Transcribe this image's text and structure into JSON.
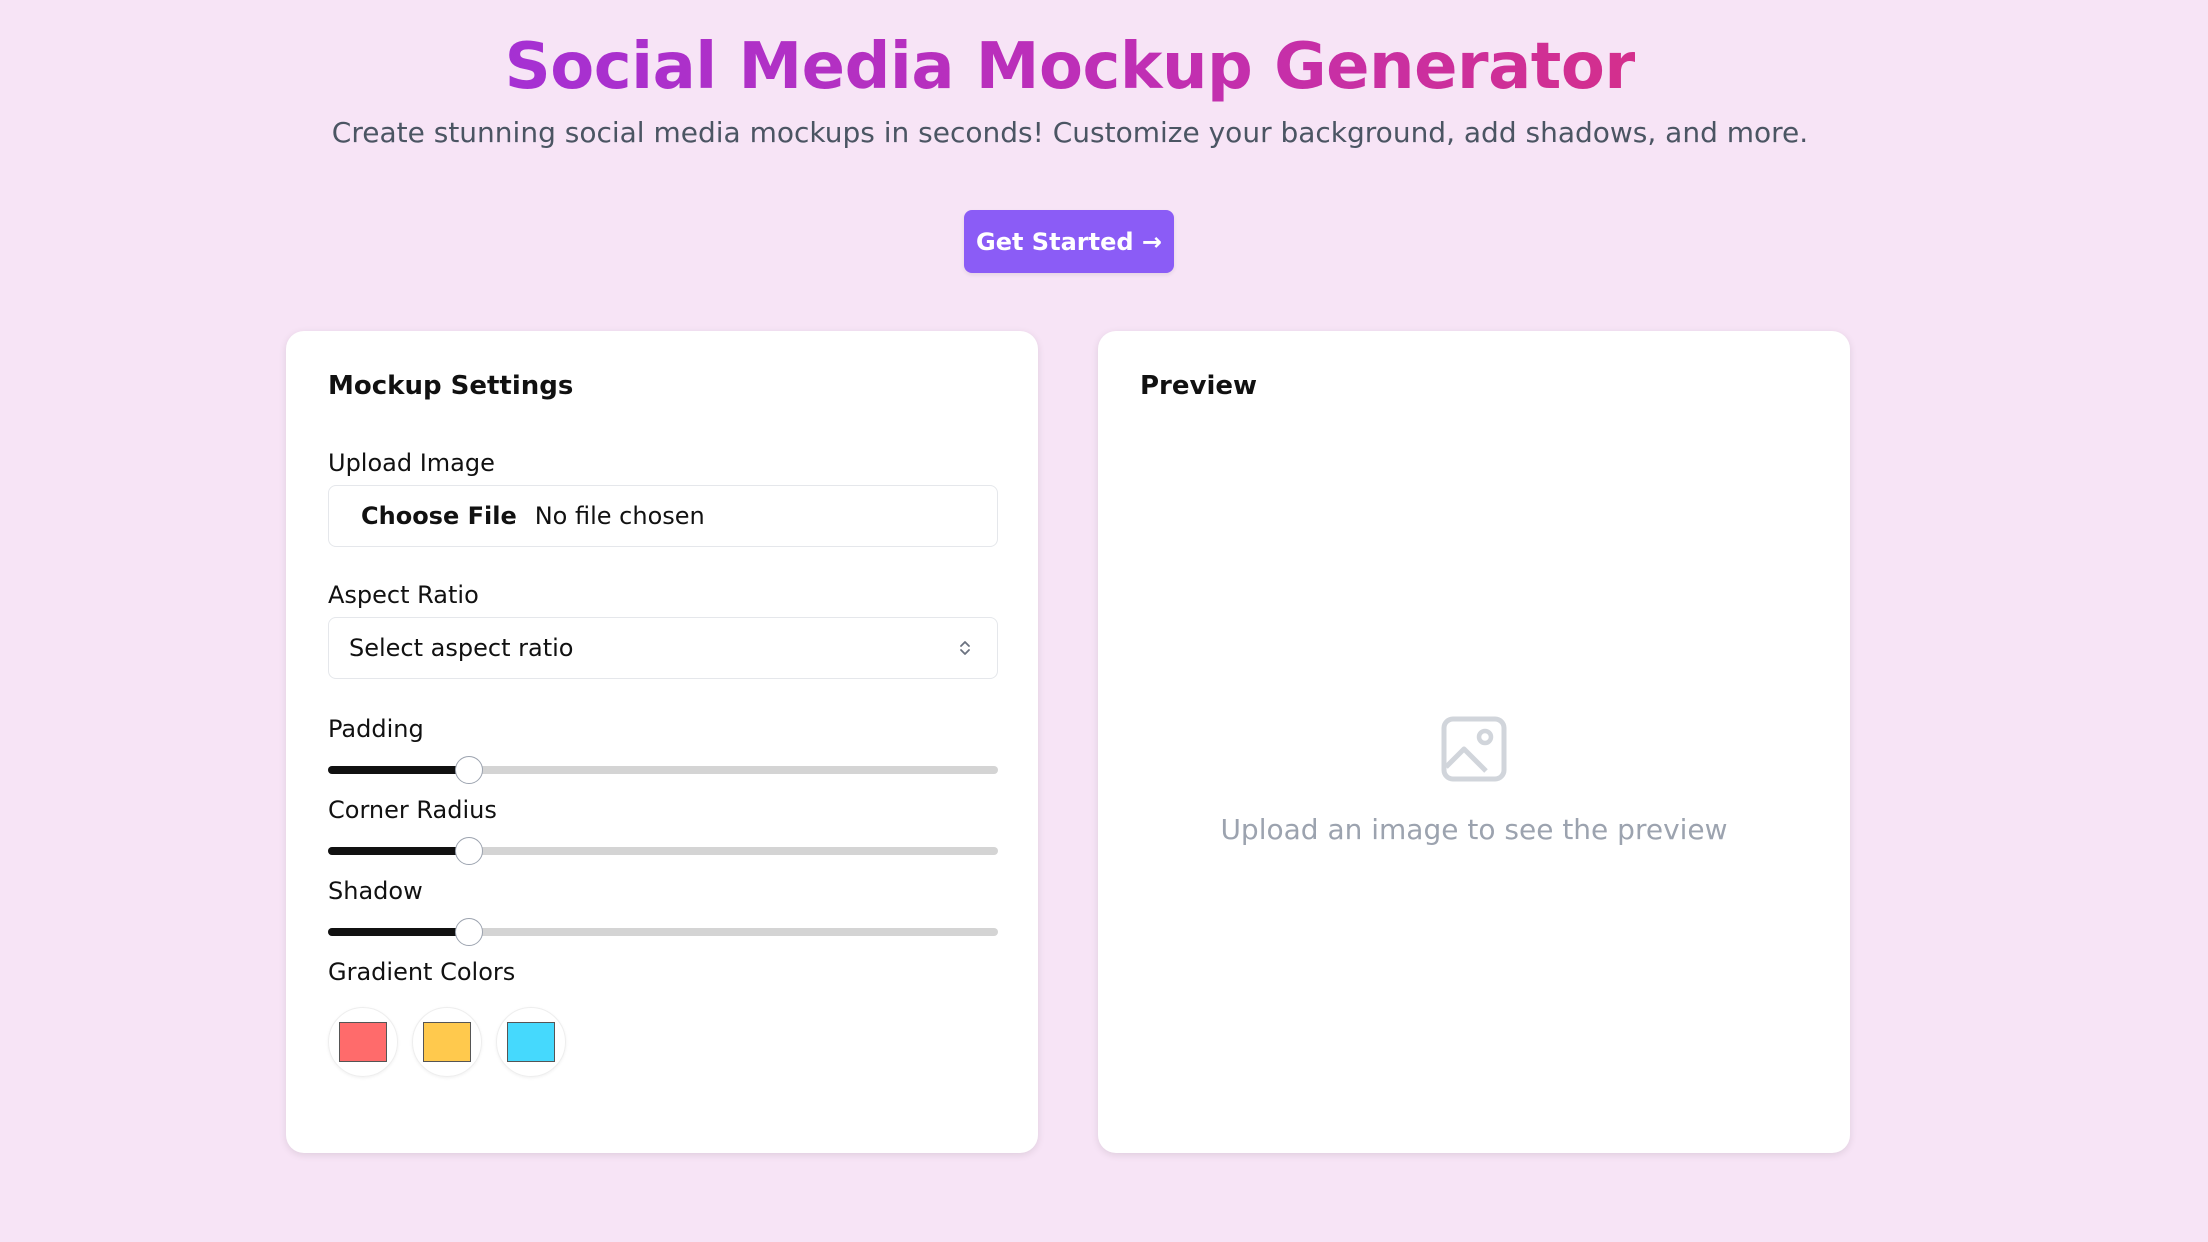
{
  "header": {
    "title": "Social Media Mockup Generator",
    "subtitle": "Create stunning social media mockups in seconds! Customize your background, add shadows, and more.",
    "cta_label": "Get Started →"
  },
  "settings": {
    "title": "Mockup Settings",
    "upload": {
      "label": "Upload Image",
      "button_label": "Choose File",
      "status": "No file chosen"
    },
    "aspect_ratio": {
      "label": "Aspect Ratio",
      "placeholder": "Select aspect ratio",
      "icon": "chevron-up-down-icon"
    },
    "sliders": [
      {
        "label": "Padding",
        "value_fraction": 0.21
      },
      {
        "label": "Corner Radius",
        "value_fraction": 0.21
      },
      {
        "label": "Shadow",
        "value_fraction": 0.21
      }
    ],
    "gradient": {
      "label": "Gradient Colors",
      "colors": [
        "#ff6b6b",
        "#ffc94d",
        "#45d9fd"
      ]
    }
  },
  "preview": {
    "title": "Preview",
    "empty_icon": "image-icon",
    "empty_text": "Upload an image to see the preview"
  },
  "theme": {
    "page_bg": "#f7e4f6",
    "accent": "#8b5cf6",
    "title_gradient": [
      "#a530d3",
      "#d42f8d"
    ]
  }
}
